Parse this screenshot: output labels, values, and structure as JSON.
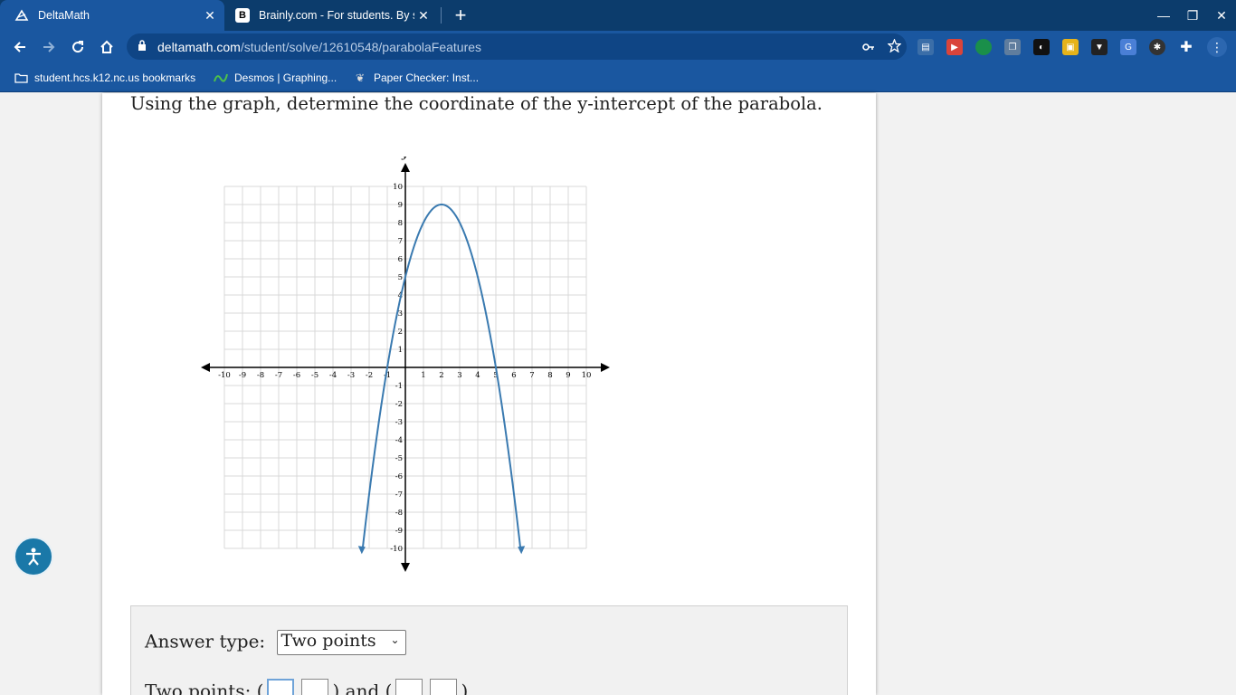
{
  "browser": {
    "tabs": [
      {
        "title": "DeltaMath",
        "favicon": "deltamath-icon",
        "close": "✕"
      },
      {
        "title": "Brainly.com - For students. By st",
        "favicon": "brainly-icon",
        "favicon_glyph": "B",
        "close": "✕"
      }
    ],
    "new_tab": "+",
    "window_controls": {
      "minimize": "—",
      "restore": "❐",
      "close": "✕"
    },
    "url_domain": "deltamath.com",
    "url_path": "/student/solve/12610548/parabolaFeatures",
    "bookmarks": [
      {
        "label": "student.hcs.k12.nc.us bookmarks",
        "icon": "folder-icon"
      },
      {
        "label": "Desmos | Graphing...",
        "icon": "desmos-icon"
      },
      {
        "label": "Paper Checker: Inst...",
        "icon": "paper-checker-icon"
      }
    ],
    "colors": {
      "tabstrip": "#0c3c6c",
      "toolbar": "#1a57a0"
    }
  },
  "question": {
    "text": "Using the graph, determine the coordinate of the y-intercept of the parabola."
  },
  "graph": {
    "x_label": "x",
    "y_label": "y",
    "x_ticks": [
      "-10",
      "-9",
      "-8",
      "-7",
      "-6",
      "-5",
      "-4",
      "-3",
      "-2",
      "-1",
      "1",
      "2",
      "3",
      "4",
      "5",
      "6",
      "7",
      "8",
      "9",
      "10"
    ],
    "y_ticks": [
      "10",
      "9",
      "8",
      "7",
      "6",
      "5",
      "4",
      "3",
      "2",
      "1",
      "-1",
      "-2",
      "-3",
      "-4",
      "-5",
      "-6",
      "-7",
      "-8",
      "-9",
      "-10"
    ],
    "curve_color": "#3a7ab0"
  },
  "chart_data": {
    "type": "line",
    "title": "",
    "xlabel": "x",
    "ylabel": "y",
    "xlim": [
      -10,
      10
    ],
    "ylim": [
      -10,
      10
    ],
    "grid": true,
    "function": "y = -(x-2)^2 + 9",
    "vertex": [
      2,
      9
    ],
    "x_intercepts": [
      -1,
      5
    ],
    "y_intercept": [
      0,
      5
    ],
    "series": [
      {
        "x": [
          -2.7,
          -1,
          0,
          1,
          2,
          3,
          4,
          5,
          6.7
        ],
        "y": [
          -13.1,
          0,
          5,
          8,
          9,
          8,
          5,
          0,
          -13.1
        ]
      }
    ]
  },
  "answer": {
    "type_label": "Answer type:",
    "type_value": "Two points",
    "two_points_label": "Two points:",
    "and_label": "and",
    "open_paren": "(",
    "close_paren": ")"
  }
}
